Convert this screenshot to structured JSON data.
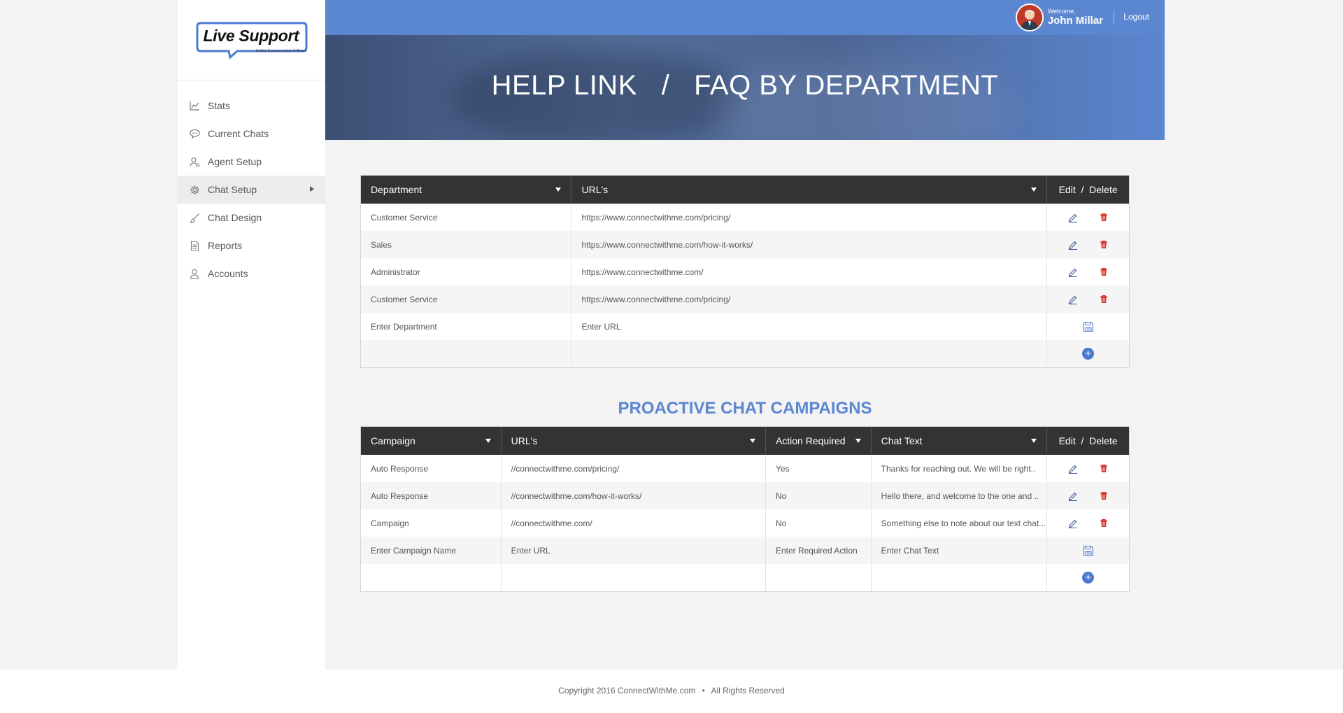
{
  "logo": {
    "title": "Live Support",
    "subtitle": "Unified Communication Software"
  },
  "sidebar": {
    "items": [
      {
        "label": "Stats",
        "icon": "stats-chart-icon"
      },
      {
        "label": "Current Chats",
        "icon": "chat-bubble-icon"
      },
      {
        "label": "Agent Setup",
        "icon": "user-gear-icon"
      },
      {
        "label": "Chat Setup",
        "icon": "gear-icon"
      },
      {
        "label": "Chat Design",
        "icon": "brush-icon"
      },
      {
        "label": "Reports",
        "icon": "document-icon"
      },
      {
        "label": "Accounts",
        "icon": "user-icon"
      }
    ]
  },
  "header": {
    "welcome": "Welcome,",
    "user_name": "John Millar",
    "logout": "Logout",
    "page_title": "HELP LINK   /   FAQ BY DEPARTMENT"
  },
  "faq_table": {
    "headers": {
      "department": "Department",
      "urls": "URL's",
      "actions": "Edit  /  Delete"
    },
    "rows": [
      {
        "department": "Customer Service",
        "url": "https://www.connectwithme.com/pricing/"
      },
      {
        "department": "Sales",
        "url": "https://www.connectwithme.com/how-it-works/"
      },
      {
        "department": "Administrator",
        "url": "https://www.connectwithme.com/"
      },
      {
        "department": "Customer Service",
        "url": "https://www.connectwithme.com/pricing/"
      }
    ],
    "new_row": {
      "department_placeholder": "Enter Department",
      "url_placeholder": "Enter URL"
    },
    "add_symbol": "+"
  },
  "campaigns": {
    "title": "PROACTIVE CHAT CAMPAIGNS",
    "headers": {
      "campaign": "Campaign",
      "urls": "URL's",
      "action_required": "Action Required",
      "chat_text": "Chat Text",
      "actions": "Edit  /  Delete"
    },
    "rows": [
      {
        "campaign": "Auto Response",
        "url": "//connectwithme.com/pricing/",
        "action_required": "Yes",
        "chat_text": "Thanks for reaching out. We will be right.."
      },
      {
        "campaign": "Auto Response",
        "url": "//connectwithme.com/how-it-works/",
        "action_required": "No",
        "chat_text": "Hello there, and welcome to the one and .."
      },
      {
        "campaign": "Campaign",
        "url": "//connectwithme.com/",
        "action_required": "No",
        "chat_text": "Something else to note about our text chat..."
      }
    ],
    "new_row": {
      "campaign_placeholder": "Enter Campaign Name",
      "url_placeholder": "Enter URL",
      "action_placeholder": "Enter Required Action",
      "chat_text_placeholder": "Enter Chat Text"
    },
    "add_symbol": "+"
  },
  "footer": {
    "copyright": "Copyright 2016 ConnectWithMe.com",
    "separator": "•",
    "rights": "All Rights Reserved"
  },
  "colors": {
    "accent": "#5b86d0",
    "header_dark": "#333333",
    "delete": "#d9302c",
    "edit": "#3a5a9a"
  }
}
